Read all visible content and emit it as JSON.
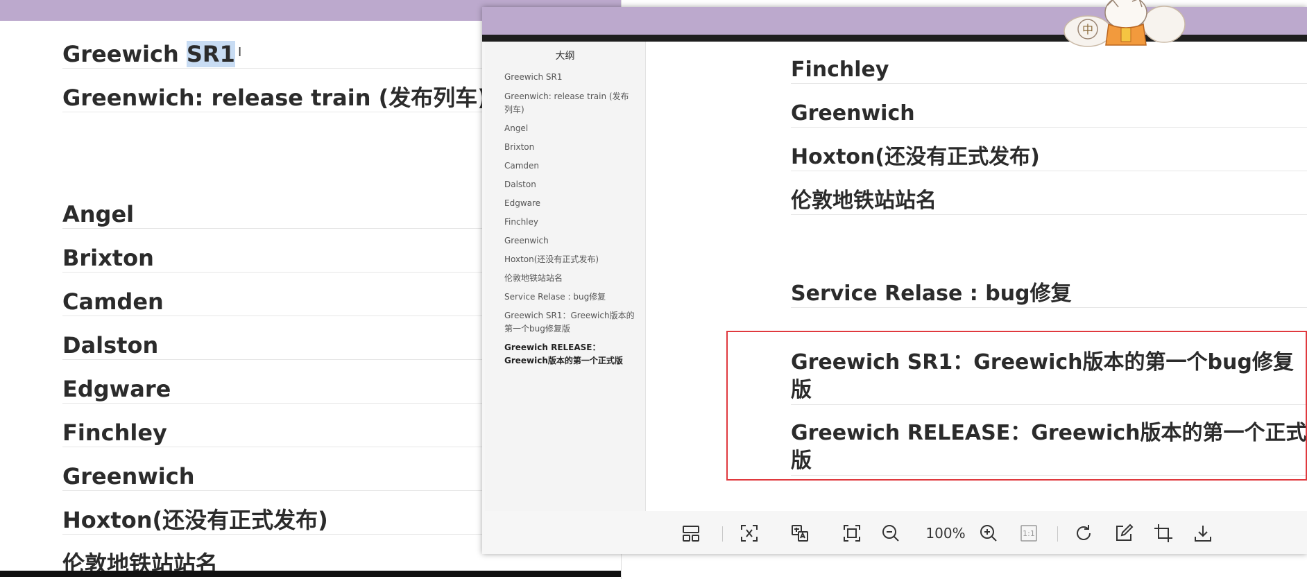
{
  "background_editor": {
    "lines": [
      {
        "before": "Greewich ",
        "selected": "SR1"
      },
      {
        "text": "Greenwich: release train (发布列车)"
      },
      {
        "text": "Angel"
      },
      {
        "text": "Brixton"
      },
      {
        "text": "Camden"
      },
      {
        "text": "Dalston"
      },
      {
        "text": "Edgware"
      },
      {
        "text": "Finchley"
      },
      {
        "text": "Greenwich"
      },
      {
        "text": "Hoxton(还没有正式发布)"
      },
      {
        "text": "伦敦地铁站站名"
      }
    ]
  },
  "viewer": {
    "outline": {
      "title": "大纲",
      "items": [
        "Greewich SR1",
        "Greenwich: release train (发布列车)",
        "Angel",
        "Brixton",
        "Camden",
        "Dalston",
        "Edgware",
        "Finchley",
        "Greenwich",
        "Hoxton(还没有正式发布)",
        "伦敦地铁站站名",
        "Service Relase : bug修复",
        "Greewich SR1：Greewich版本的第一个bug修复版",
        "Greewich RELEASE：Greewich版本的第一个正式版"
      ],
      "active_index": 13
    },
    "doc": {
      "lines": [
        "Finchley",
        "Greenwich",
        "Hoxton(还没有正式发布)",
        "伦敦地铁站站名",
        "Service Relase : bug修复",
        "Greewich SR1：Greewich版本的第一个bug修复版",
        "Greewich RELEASE：Greewich版本的第一个正式版"
      ]
    },
    "toolbar": {
      "zoom_level": "100%",
      "actual_size_label": "1:1"
    },
    "mascot": {
      "badge": "中"
    }
  },
  "colors": {
    "titlebar": "#bca9cd",
    "highlight": "#e0393e",
    "selection": "#c8dcf3"
  }
}
